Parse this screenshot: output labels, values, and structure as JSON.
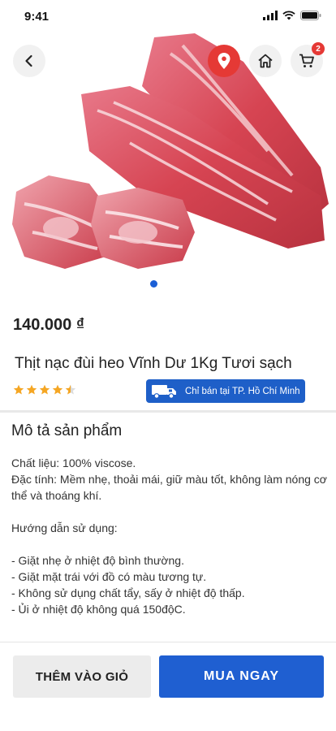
{
  "status_bar": {
    "time": "9:41"
  },
  "header": {
    "cart_count": "2"
  },
  "gallery": {
    "active_index": 1,
    "count": 1
  },
  "product": {
    "price": "140.000 ₫",
    "title": "Thịt nạc đùi heo Vĩnh Dư 1Kg Tươi sạch",
    "rating": 4.5,
    "delivery_note": "Chỉ bán tại TP. Hồ Chí Minh"
  },
  "description": {
    "heading": "Mô tả sản phẩm",
    "material": "Chất liệu: 100% viscose.",
    "features": "Đặc tính: Mềm nhẹ, thoải mái, giữ màu tốt, không làm nóng cơ thể và thoáng khí.",
    "usage_heading": "Hướng dẫn sử dụng:",
    "usage_items": [
      "- Giặt nhẹ ở nhiệt độ bình thường.",
      "- Giặt mặt trái với đồ có màu tương tự.",
      "- Không sử dụng chất tẩy, sấy ở nhiệt độ thấp.",
      "- Ủi ở nhiệt độ không quá 150độC."
    ]
  },
  "actions": {
    "add_to_cart": "THÊM VÀO GIỎ",
    "buy_now": "MUA NGAY"
  },
  "colors": {
    "accent": "#1f5fd1",
    "danger": "#e53935",
    "star": "#f5a623"
  }
}
